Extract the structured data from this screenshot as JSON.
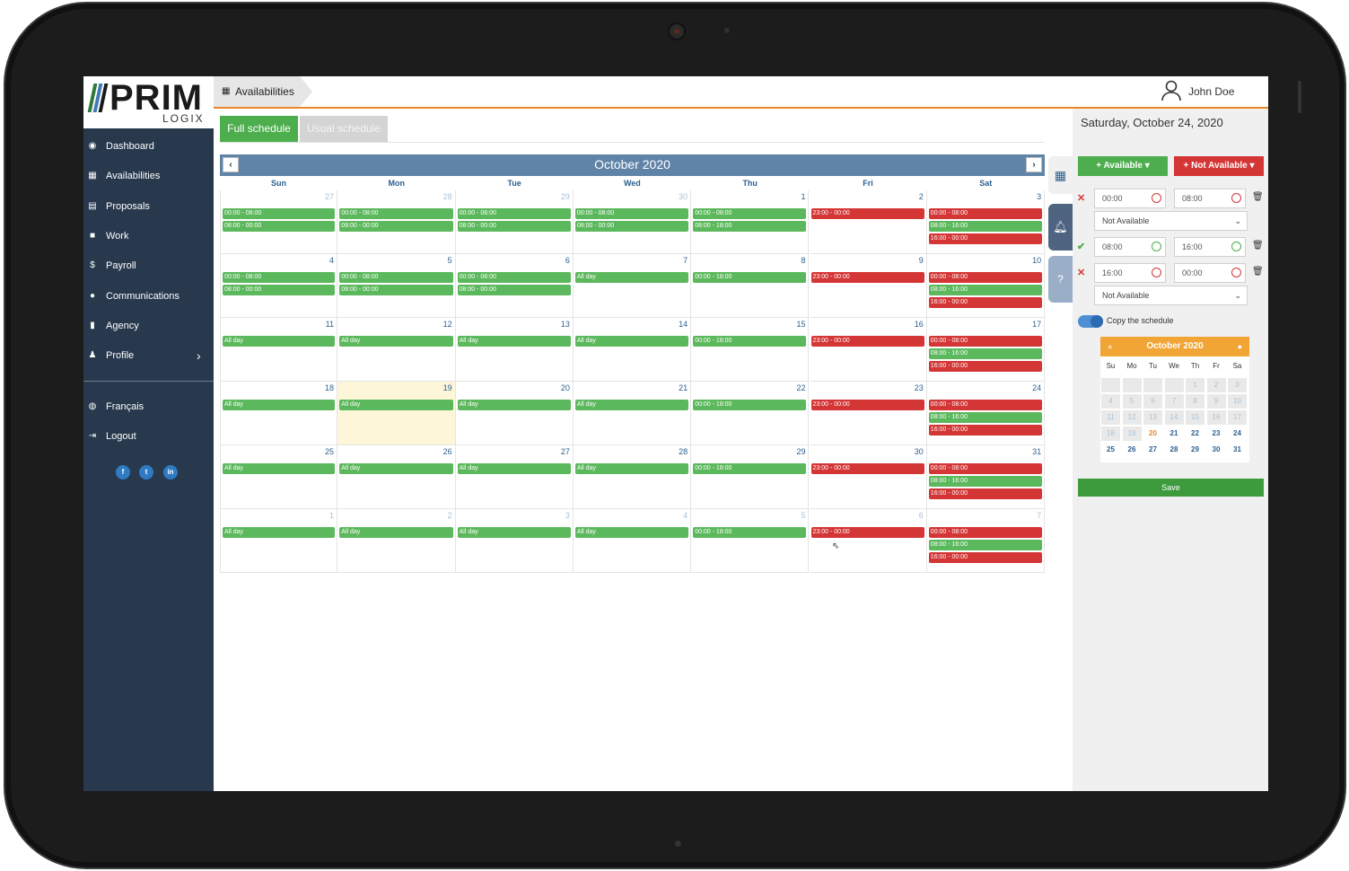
{
  "logo": {
    "name": "PRIM",
    "sub": "LOGIX"
  },
  "sidebar": {
    "items": [
      {
        "label": "Dashboard",
        "icon": "dashboard-icon"
      },
      {
        "label": "Availabilities",
        "icon": "calendar-icon"
      },
      {
        "label": "Proposals",
        "icon": "proposals-icon"
      },
      {
        "label": "Work",
        "icon": "briefcase-icon"
      },
      {
        "label": "Payroll",
        "icon": "dollar-icon"
      },
      {
        "label": "Communications",
        "icon": "comments-icon"
      },
      {
        "label": "Agency",
        "icon": "building-icon"
      },
      {
        "label": "Profile",
        "icon": "user-icon"
      }
    ],
    "bottom_items": [
      {
        "label": "Français",
        "icon": "globe-icon"
      },
      {
        "label": "Logout",
        "icon": "logout-icon"
      }
    ],
    "social": [
      "f",
      "t",
      "in"
    ]
  },
  "header": {
    "breadcrumb": "Availabilities",
    "user_name": "John Doe"
  },
  "tabs": {
    "full": "Full schedule",
    "usual": "Usual schedule"
  },
  "calendar": {
    "title": "October 2020",
    "prev": "‹",
    "next": "›",
    "days_of_week": [
      "Sun",
      "Mon",
      "Tue",
      "Wed",
      "Thu",
      "Fri",
      "Sat"
    ],
    "weeks": [
      [
        {
          "d": "27",
          "other": true,
          "ev": [
            [
              "g",
              "00:00 - 08:00"
            ],
            [
              "g",
              "08:00 - 00:00"
            ]
          ]
        },
        {
          "d": "28",
          "other": true,
          "ev": [
            [
              "g",
              "00:00 - 08:00"
            ],
            [
              "g",
              "08:00 - 00:00"
            ]
          ]
        },
        {
          "d": "29",
          "other": true,
          "ev": [
            [
              "g",
              "00:00 - 08:00"
            ],
            [
              "g",
              "08:00 - 00:00"
            ]
          ]
        },
        {
          "d": "30",
          "other": true,
          "ev": [
            [
              "g",
              "00:00 - 08:00"
            ],
            [
              "g",
              "08:00 - 00:00"
            ]
          ]
        },
        {
          "d": "1",
          "ev": [
            [
              "g",
              "00:00 - 08:00"
            ],
            [
              "g",
              "08:00 - 18:00"
            ]
          ]
        },
        {
          "d": "2",
          "ev": [
            [
              "r",
              "23:00 - 00:00"
            ]
          ]
        },
        {
          "d": "3",
          "ev": [
            [
              "r",
              "00:00 - 08:00"
            ],
            [
              "g",
              "08:00 - 16:00"
            ],
            [
              "r",
              "16:00 - 00:00"
            ]
          ]
        }
      ],
      [
        {
          "d": "4",
          "ev": [
            [
              "g",
              "00:00 - 08:00"
            ],
            [
              "g",
              "08:00 - 00:00"
            ]
          ]
        },
        {
          "d": "5",
          "ev": [
            [
              "g",
              "00:00 - 08:00"
            ],
            [
              "g",
              "08:00 - 00:00"
            ]
          ]
        },
        {
          "d": "6",
          "ev": [
            [
              "g",
              "00:00 - 08:00"
            ],
            [
              "g",
              "08:00 - 00:00"
            ]
          ]
        },
        {
          "d": "7",
          "ev": [
            [
              "g",
              "All day"
            ]
          ]
        },
        {
          "d": "8",
          "ev": [
            [
              "g",
              "00:00 - 18:00"
            ]
          ]
        },
        {
          "d": "9",
          "ev": [
            [
              "r",
              "23:00 - 00:00"
            ]
          ]
        },
        {
          "d": "10",
          "ev": [
            [
              "r",
              "00:00 - 08:00"
            ],
            [
              "g",
              "08:00 - 16:00"
            ],
            [
              "r",
              "16:00 - 00:00"
            ]
          ]
        }
      ],
      [
        {
          "d": "11",
          "ev": [
            [
              "g",
              "All day"
            ]
          ]
        },
        {
          "d": "12",
          "ev": [
            [
              "g",
              "All day"
            ]
          ]
        },
        {
          "d": "13",
          "ev": [
            [
              "g",
              "All day"
            ]
          ]
        },
        {
          "d": "14",
          "ev": [
            [
              "g",
              "All day"
            ]
          ]
        },
        {
          "d": "15",
          "ev": [
            [
              "g",
              "00:00 - 18:00"
            ]
          ]
        },
        {
          "d": "16",
          "ev": [
            [
              "r",
              "23:00 - 00:00"
            ]
          ]
        },
        {
          "d": "17",
          "ev": [
            [
              "r",
              "00:00 - 08:00"
            ],
            [
              "g",
              "08:00 - 16:00"
            ],
            [
              "r",
              "16:00 - 00:00"
            ]
          ]
        }
      ],
      [
        {
          "d": "18",
          "ev": [
            [
              "g",
              "All day"
            ]
          ]
        },
        {
          "d": "19",
          "today": true,
          "ev": [
            [
              "g",
              "All day"
            ]
          ]
        },
        {
          "d": "20",
          "ev": [
            [
              "g",
              "All day"
            ]
          ]
        },
        {
          "d": "21",
          "ev": [
            [
              "g",
              "All day"
            ]
          ]
        },
        {
          "d": "22",
          "ev": [
            [
              "g",
              "00:00 - 18:00"
            ]
          ]
        },
        {
          "d": "23",
          "ev": [
            [
              "r",
              "23:00 - 00:00"
            ]
          ]
        },
        {
          "d": "24",
          "ev": [
            [
              "r",
              "00:00 - 08:00"
            ],
            [
              "g",
              "08:00 - 16:00"
            ],
            [
              "r",
              "16:00 - 00:00"
            ]
          ]
        }
      ],
      [
        {
          "d": "25",
          "ev": [
            [
              "g",
              "All day"
            ]
          ]
        },
        {
          "d": "26",
          "ev": [
            [
              "g",
              "All day"
            ]
          ]
        },
        {
          "d": "27",
          "ev": [
            [
              "g",
              "All day"
            ]
          ]
        },
        {
          "d": "28",
          "ev": [
            [
              "g",
              "All day"
            ]
          ]
        },
        {
          "d": "29",
          "ev": [
            [
              "g",
              "00:00 - 18:00"
            ]
          ]
        },
        {
          "d": "30",
          "ev": [
            [
              "r",
              "23:00 - 00:00"
            ]
          ]
        },
        {
          "d": "31",
          "ev": [
            [
              "r",
              "00:00 - 08:00"
            ],
            [
              "g",
              "08:00 - 16:00"
            ],
            [
              "r",
              "16:00 - 00:00"
            ]
          ]
        }
      ],
      [
        {
          "d": "1",
          "other": true,
          "ev": [
            [
              "g",
              "All day"
            ]
          ]
        },
        {
          "d": "2",
          "other": true,
          "ev": [
            [
              "g",
              "All day"
            ]
          ]
        },
        {
          "d": "3",
          "other": true,
          "ev": [
            [
              "g",
              "All day"
            ]
          ]
        },
        {
          "d": "4",
          "other": true,
          "ev": [
            [
              "g",
              "All day"
            ]
          ]
        },
        {
          "d": "5",
          "other": true,
          "ev": [
            [
              "g",
              "00:00 - 18:00"
            ]
          ]
        },
        {
          "d": "6",
          "other": true,
          "ev": [
            [
              "r",
              "23:00 - 00:00"
            ]
          ]
        },
        {
          "d": "7",
          "other": true,
          "ev": [
            [
              "r",
              "00:00 - 08:00"
            ],
            [
              "g",
              "08:00 - 16:00"
            ],
            [
              "r",
              "16:00 - 00:00"
            ]
          ]
        }
      ]
    ]
  },
  "panel": {
    "date": "Saturday, October 24, 2020",
    "available_btn": "+ Available ▾",
    "not_available_btn": "+ Not Available ▾",
    "rows": [
      {
        "status": "✕",
        "status_color": "#d43535",
        "from": "00:00",
        "to": "08:00",
        "clock_color": "#d43535",
        "select": "Not Available"
      },
      {
        "status": "✔",
        "status_color": "#4cae4c",
        "from": "08:00",
        "to": "16:00",
        "clock_color": "#4cae4c",
        "select": null
      },
      {
        "status": "✕",
        "status_color": "#d43535",
        "from": "16:00",
        "to": "00:00",
        "clock_color": "#d43535",
        "select": "Not Available"
      }
    ],
    "copy_label": "Copy the schedule",
    "save": "Save"
  },
  "mini_calendar": {
    "title": "October 2020",
    "days_of_week": [
      "Su",
      "Mo",
      "Tu",
      "We",
      "Th",
      "Fr",
      "Sa"
    ],
    "weeks": [
      [
        "",
        "",
        "",
        "",
        "1",
        "2",
        "3"
      ],
      [
        "4",
        "5",
        "6",
        "7",
        "8",
        "9",
        "10"
      ],
      [
        "11",
        "12",
        "13",
        "14",
        "15",
        "16",
        "17"
      ],
      [
        "18",
        "19",
        "20",
        "21",
        "22",
        "23",
        "24"
      ],
      [
        "25",
        "26",
        "27",
        "28",
        "29",
        "30",
        "31"
      ]
    ],
    "today": "20",
    "first_selectable": 20
  },
  "colors": {
    "sidebar": "#28394e",
    "accent": "#e9862a",
    "available": "#5cb85c",
    "not_available": "#d43535",
    "calendar_header": "#6084a8"
  }
}
